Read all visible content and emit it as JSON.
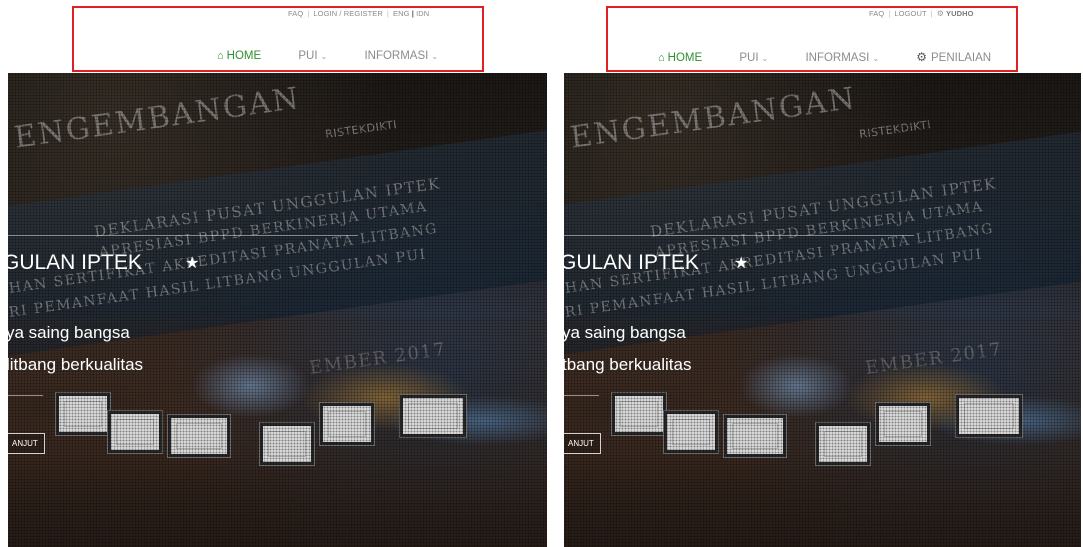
{
  "left": {
    "topbar": {
      "faq": "FAQ",
      "login": "LOGIN / REGISTER",
      "eng": "ENG",
      "idn": "IDN"
    },
    "nav": {
      "home": "HOME",
      "pui": "PUI",
      "informasi": "INFORMASI"
    },
    "hero": {
      "title": "GULAN IPTEK",
      "line1": "ya saing bangsa",
      "line2": "litbang berkualitas",
      "button": "ANJUT"
    }
  },
  "right": {
    "topbar": {
      "faq": "FAQ",
      "logout": "LOGOUT",
      "user": "YUDHO"
    },
    "nav": {
      "home": "HOME",
      "pui": "PUI",
      "informasi": "INFORMASI",
      "penilaian": "PENILAIAN"
    },
    "hero": {
      "title": "GULAN IPTEK",
      "line1": "ya saing bangsa",
      "line2": "tbang berkualitas",
      "button": "ANJUT"
    }
  },
  "background_text": {
    "big": "ENGEMBANGAN",
    "logo": "RISTEKDIKTI",
    "l1": "DEKLARASI PUSAT UNGGULAN IPTEK",
    "l2": "APRESIASI BPPD BERKINERJA UTAMA",
    "l3": "HAN SERTIFIKAT AKREDITASI PRANATA LITBANG",
    "l4": "RI PEMANFAAT HASIL LITBANG UNGGULAN PUI",
    "year": "EMBER 2017"
  },
  "colors": {
    "nav_active": "#2f8f2f",
    "annotation": "#e02020"
  },
  "icons": {
    "home": "home-icon",
    "chevron": "chevron-down-icon",
    "cog": "cogs-icon",
    "user": "user-gear-icon",
    "star": "star-icon"
  }
}
